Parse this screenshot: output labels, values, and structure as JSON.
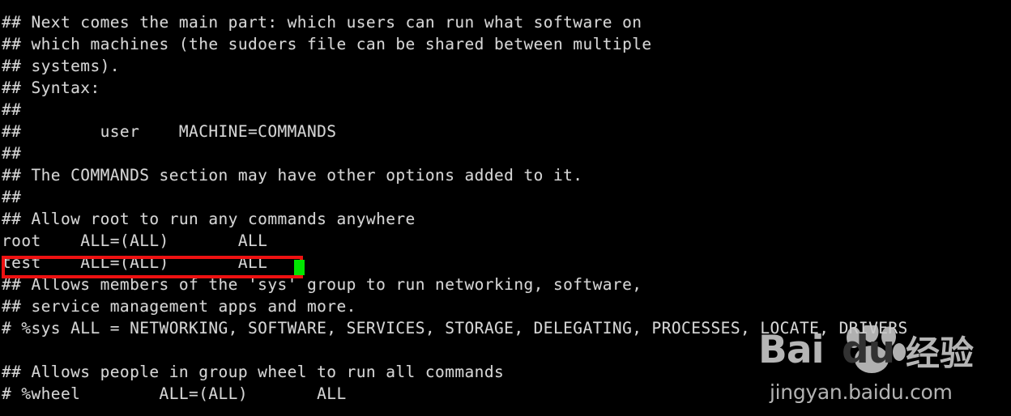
{
  "terminal": {
    "background_color": "#000000",
    "text_color": "#d6d6d6",
    "cursor_color": "#00e500",
    "highlight_color": "#ee1111",
    "lines": [
      "## Next comes the main part: which users can run what software on",
      "## which machines (the sudoers file can be shared between multiple",
      "## systems).",
      "## Syntax:",
      "##",
      "##        user    MACHINE=COMMANDS",
      "##",
      "## The COMMANDS section may have other options added to it.",
      "##",
      "## Allow root to run any commands anywhere",
      "root    ALL=(ALL)       ALL",
      "test    ALL=(ALL)       ALL",
      "## Allows members of the 'sys' group to run networking, software,",
      "## service management apps and more.",
      "# %sys ALL = NETWORKING, SOFTWARE, SERVICES, STORAGE, DELEGATING, PROCESSES, LOCATE, DRIVERS",
      "",
      "## Allows people in group wheel to run all commands",
      "# %wheel        ALL=(ALL)       ALL"
    ]
  },
  "watermark": {
    "brand_bai": "Bai",
    "brand_du": "du",
    "brand_cn": "经验",
    "url": "jingyan.baidu.com"
  }
}
